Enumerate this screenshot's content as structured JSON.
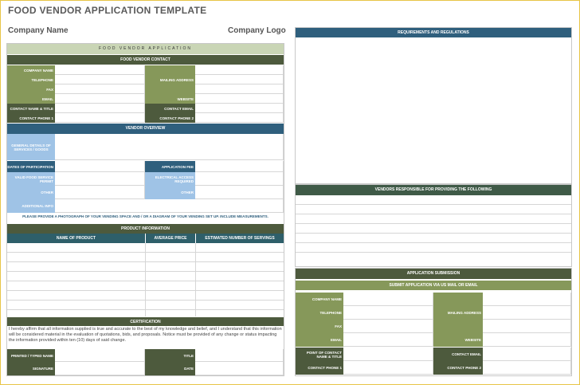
{
  "header": {
    "title": "FOOD VENDOR APPLICATION TEMPLATE",
    "company_name": "Company Name",
    "company_logo": "Company Logo"
  },
  "form": {
    "banner": "FOOD VENDOR APPLICATION",
    "contact": {
      "heading": "FOOD VENDOR CONTACT",
      "company_name": "COMPANY NAME",
      "telephone": "TELEPHONE",
      "fax": "FAX",
      "email": "EMAIL",
      "mailing_address": "MAILING ADDRESS",
      "website": "WEBSITE",
      "contact_name_title": "CONTACT NAME & TITLE",
      "contact_email": "CONTACT EMAIL",
      "contact_phone_1": "CONTACT PHONE 1",
      "contact_phone_2": "CONTACT PHONE 2"
    },
    "overview": {
      "heading": "VENDOR OVERVIEW",
      "general_details": "GENERAL DETAILS OF SERVICES / GOODS",
      "dates": "DATES OF PARTICIPATION",
      "application_fee": "APPLICATION FEE",
      "food_service": "VALID FOOD SERVICE PERMIT",
      "electrical": "ELECTRICAL ACCESS REQUIRED",
      "other_left": "OTHER",
      "other_right": "OTHER",
      "additional_info": "ADDITIONAL INFO",
      "photo_note": "PLEASE PROVIDE A PHOTOGRAPH OF YOUR VENDING SPACE AND / OR A DIAGRAM OF YOUR VENDING SET UP. INCLUDE MEASUREMENTS."
    },
    "products": {
      "heading": "PRODUCT INFORMATION",
      "col_name": "NAME OF PRODUCT",
      "col_price": "AVERAGE PRICE",
      "col_servings": "ESTIMATED NUMBER OF SERVINGS"
    },
    "certification": {
      "heading": "CERTIFICATION",
      "text": "I hereby affirm that all information supplied is true and accurate to the best of my knowledge and belief, and I understand that this information will be considered material in the evaluation of quotations, bids, and proposals. Notice must be provided of any change or status impacting the information provided within ten (10) days of said change.",
      "printed_name": "PRINTED / TYPED NAME",
      "title": "TITLE",
      "signature": "SIGNATURE",
      "date": "DATE"
    }
  },
  "right": {
    "requirements": "REQUIREMENTS AND REGULATIONS",
    "vendors_responsible": "VENDORS RESPONSIBLE FOR PROVIDING THE FOLLOWING",
    "submission": {
      "heading": "APPLICATION SUBMISSION",
      "sub": "SUBMIT APPLICATION VIA US MAIL OR EMAIL",
      "company_name": "COMPANY NAME",
      "telephone": "TELEPHONE",
      "fax": "FAX",
      "email": "EMAIL",
      "mailing_address": "MAILING ADDRESS",
      "website": "WEBSITE",
      "point_of_contact": "POINT OF CONTACT NAME & TITLE",
      "contact_email": "CONTACT EMAIL",
      "contact_phone_1": "CONTACT PHONE 1",
      "contact_phone_2": "CONTACT PHONE 2"
    }
  },
  "colors": {
    "olive": "#4d5a3d",
    "blue": "#2f5f7d",
    "light_blue": "#9fc3e6",
    "light_green": "#86985a",
    "border": "#e8c547"
  }
}
